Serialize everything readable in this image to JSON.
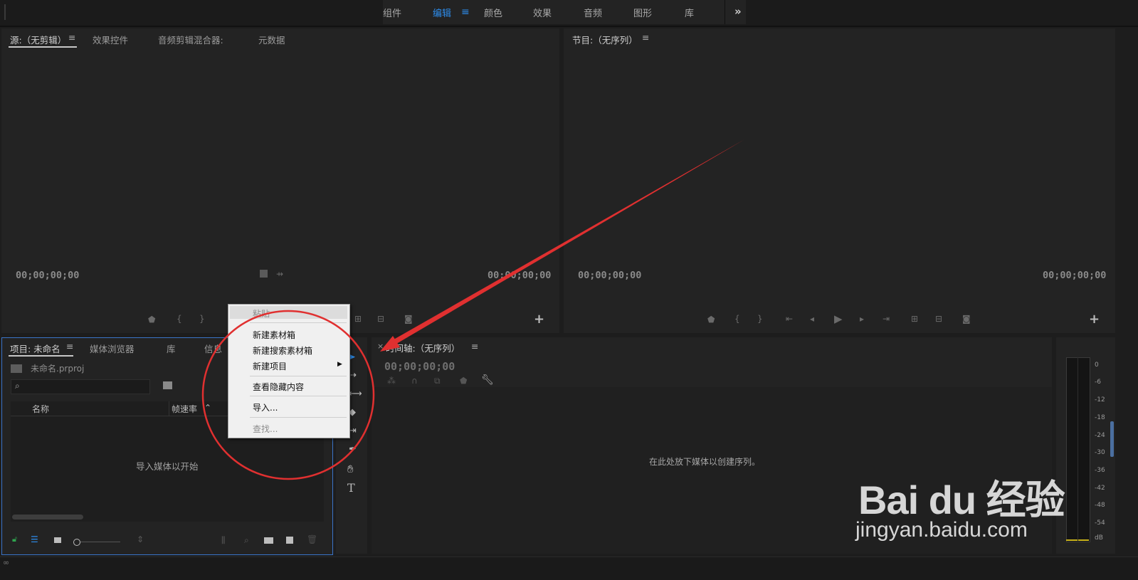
{
  "workspaces": {
    "tabs": [
      "组件",
      "编辑",
      "颜色",
      "效果",
      "音频",
      "图形",
      "库"
    ],
    "active": "编辑",
    "overflow_icon": "double-chevron-right-icon"
  },
  "source_panel": {
    "tabs": [
      "源:（无剪辑）",
      "效果控件",
      "音频剪辑混合器:",
      "元数据"
    ],
    "timecode_left": "00;00;00;00",
    "timecode_right": "00;00;00;00"
  },
  "program_panel": {
    "title": "节目:（无序列）",
    "timecode_left": "00;00;00;00",
    "timecode_right": "00;00;00;00"
  },
  "project_panel": {
    "tabs": [
      "项目: 未命名",
      "媒体浏览器",
      "库",
      "信息"
    ],
    "project_file": "未命名.prproj",
    "search_placeholder": "",
    "col_name": "名称",
    "col_fps": "帧速率",
    "empty_text": "导入媒体以开始"
  },
  "context_menu": {
    "paste": "粘贴",
    "new_bin": "新建素材箱",
    "new_search_bin": "新建搜索素材箱",
    "new_item": "新建项目",
    "view_hidden": "查看隐藏内容",
    "import": "导入...",
    "find": "查找..."
  },
  "timeline_panel": {
    "title": "时间轴:（无序列）",
    "timecode": "00;00;00;00",
    "drop_text": "在此处放下媒体以创建序列。"
  },
  "audio_meter": {
    "scale": [
      "0",
      "-6",
      "-12",
      "-18",
      "-24",
      "-30",
      "-36",
      "-42",
      "-48",
      "-54",
      "dB"
    ]
  },
  "watermark": {
    "brand": "Bai du 经验",
    "url": "jingyan.baidu.com"
  },
  "colors": {
    "accent": "#2d8ceb",
    "annotation": "#e03030",
    "panel_bg": "#232323",
    "app_bg": "#1d1d1d"
  }
}
